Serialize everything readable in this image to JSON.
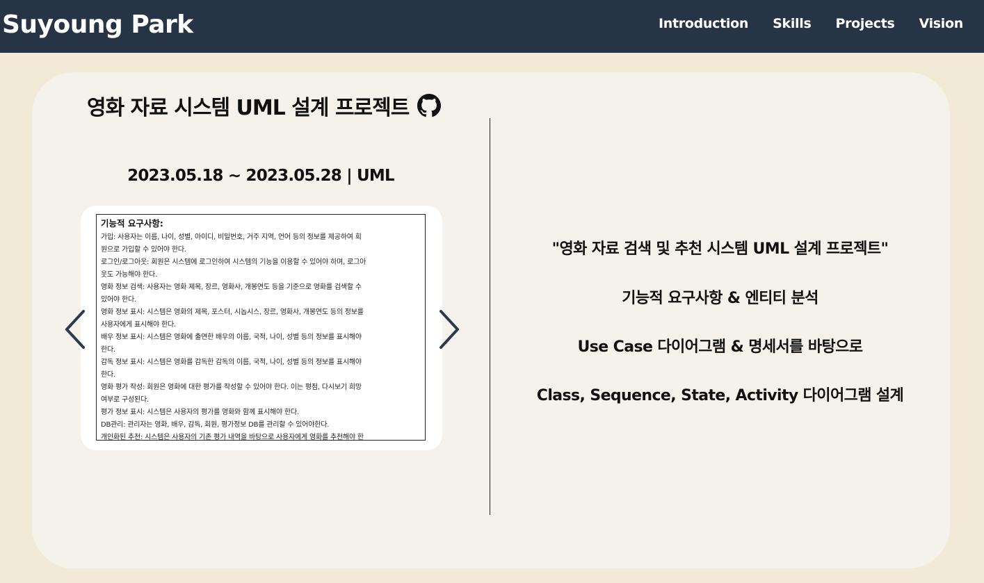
{
  "header": {
    "brand": "Suyoung Park",
    "nav": [
      "Introduction",
      "Skills",
      "Projects",
      "Vision"
    ]
  },
  "project": {
    "title": "영화 자료 시스템 UML 설계 프로젝트",
    "github_icon": "github-icon",
    "dates": "2023.05.18 ~ 2023.05.28 | UML",
    "slide": {
      "heading": "기능적 요구사항:",
      "lines": [
        "가입: 사용자는 이름, 나이, 성별, 아이디, 비밀번호, 거주 지역, 언어 등의 정보를 제공하여 회",
        "원으로 가입할 수 있어야 한다.",
        "로그인/로그아웃: 회원은 시스템에 로그인하여 시스템의 기능을 이용할 수 있어야 하며, 로그아",
        "웃도 가능해야 한다.",
        "영화 정보 검색: 사용자는 영화 제목, 장르, 영화사, 개봉연도 등을 기준으로 영화를 검색할 수",
        "있어야 한다.",
        "영화 정보 표시: 시스템은 영화의 제목, 포스터, 시놉시스, 장르, 영화사, 개봉연도 등의 정보를",
        "사용자에게 표시해야 한다.",
        "배우 정보 표시: 시스템은 영화에 출연한 배우의 이름, 국적, 나이, 성별 등의 정보를 표시해야",
        "한다.",
        "감독 정보 표시: 시스템은 영화를 감독한 감독의 이름, 국적, 나이, 성별 등의 정보를 표시해야",
        "한다.",
        "영화 평가 작성: 회원은 영화에 대한 평가를 작성할 수 있어야 한다. 이는 평점, 다시보기 희망",
        "여부로 구성된다.",
        "평가 정보 표시: 시스템은 사용자의 평가를 영화와 함께 표시해야 한다.",
        "DB관리: 관리자는 영화, 배우, 감독, 회원, 평가정보 DB를 관리할 수 있어야한다.",
        "개인화된 추천: 시스템은 사용자의 기존 평가 내역을 바탕으로 사용자에게 영화를 추천해야 한"
      ],
      "prev_icon": "chevron-left-icon",
      "next_icon": "chevron-right-icon"
    },
    "description": [
      "\"영화 자료 검색 및 추천 시스템 UML 설계 프로젝트\"",
      "기능적 요구사항 & 엔티티 분석",
      "Use Case 다이어그램 & 명세서를 바탕으로",
      "Class, Sequence, State, Activity 다이어그램 설계"
    ]
  }
}
